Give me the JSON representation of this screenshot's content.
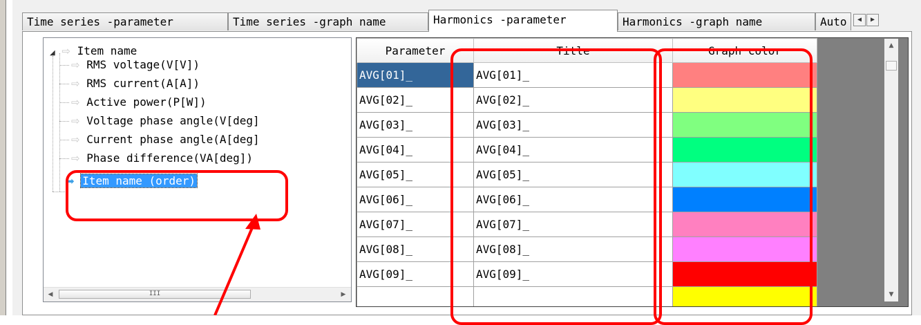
{
  "tabs": [
    {
      "label": "Time series -parameter",
      "active": false
    },
    {
      "label": "Time series -graph name",
      "active": false
    },
    {
      "label": "Harmonics -parameter",
      "active": true
    },
    {
      "label": "Harmonics -graph name",
      "active": false
    },
    {
      "label": "Auto",
      "active": false
    }
  ],
  "tree": {
    "root": "Item name",
    "children": [
      "RMS voltage(V[V])",
      "RMS current(A[A])",
      "Active power(P[W])",
      "Voltage phase angle(V[deg]",
      "Current phase angle(A[deg]",
      "Phase difference(VA[deg])"
    ],
    "selected": "Item name (order)"
  },
  "grid": {
    "headers": {
      "parameter": "Parameter",
      "title": "Title",
      "color": "Graph color"
    },
    "rows": [
      {
        "parameter": "AVG[01]_",
        "title": "AVG[01]_",
        "color": "#ff8080"
      },
      {
        "parameter": "AVG[02]_",
        "title": "AVG[02]_",
        "color": "#ffff80"
      },
      {
        "parameter": "AVG[03]_",
        "title": "AVG[03]_",
        "color": "#80ff80"
      },
      {
        "parameter": "AVG[04]_",
        "title": "AVG[04]_",
        "color": "#00ff80"
      },
      {
        "parameter": "AVG[05]_",
        "title": "AVG[05]_",
        "color": "#80ffff"
      },
      {
        "parameter": "AVG[06]_",
        "title": "AVG[06]_",
        "color": "#0080ff"
      },
      {
        "parameter": "AVG[07]_",
        "title": "AVG[07]_",
        "color": "#ff80c0"
      },
      {
        "parameter": "AVG[08]_",
        "title": "AVG[08]_",
        "color": "#ff80ff"
      },
      {
        "parameter": "AVG[09]_",
        "title": "AVG[09]_",
        "color": "#ff0000"
      }
    ],
    "partial_row_color": "#ffff00",
    "selected_color": "#336699"
  },
  "annotation_color": "#ff0000"
}
